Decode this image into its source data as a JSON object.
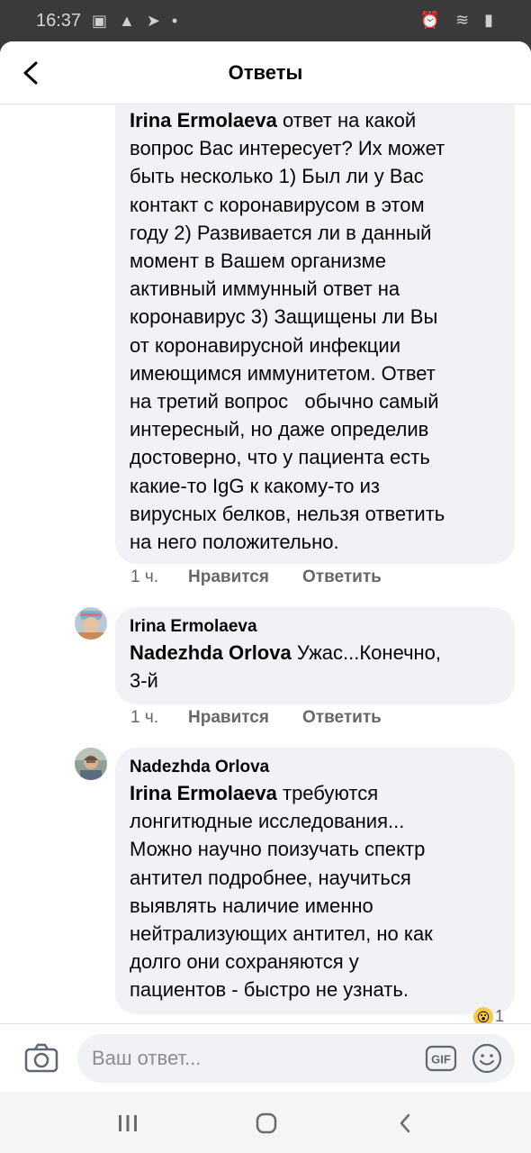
{
  "status_bar": {
    "time": "16:37",
    "notification_icons": "▣ ▲ ➤ •",
    "system_icons": "⏰ ≋ ▮"
  },
  "header": {
    "title": "Ответы"
  },
  "comments": [
    {
      "mention": "Irina Ermolaeva",
      "text_lines": [
        " ответ на какой",
        "вопрос Вас интересует? Их может",
        "быть несколько 1) Был ли у Вас",
        "контакт с коронавирусом в этом",
        "году 2) Развивается ли в данный",
        "момент в Вашем организме",
        "активный иммунный ответ на",
        "коронавирус 3) Защищены ли Вы",
        "от коронавирусной инфекции",
        "имеющимся иммунитетом. Ответ",
        "на третий вопрос   обычно самый",
        "интересный, но даже определив",
        "достоверно, что у пациента есть",
        "какие-то IgG к какому-то из",
        "вирусных белков, нельзя ответить",
        "на него положительно."
      ],
      "time": "1 ч.",
      "like_label": "Нравится",
      "reply_label": "Ответить"
    },
    {
      "author": "Irina Ermolaeva",
      "mention": "Nadezhda Orlova",
      "text_lines": [
        " Ужас...Конечно,",
        "3-й"
      ],
      "time": "1 ч.",
      "like_label": "Нравится",
      "reply_label": "Ответить"
    },
    {
      "author": "Nadezhda Orlova",
      "mention": "Irina Ermolaeva",
      "text_lines": [
        " требуются",
        "лонгитюдные исследования...",
        "Можно научно поизучать спектр",
        "антител подробнее, научиться",
        "выявлять наличие именно",
        "нейтрализующих антител, но как",
        "долго они сохраняются у",
        "пациентов - быстро не узнать."
      ],
      "reaction_count": "1"
    }
  ],
  "composer": {
    "placeholder": "Ваш ответ...",
    "gif_label": "GIF"
  },
  "colors": {
    "bubble": "#f0f2f5",
    "meta_text": "#65676b",
    "status_bar": "#3a3a3a",
    "nav_bar": "#f5f5f5"
  }
}
